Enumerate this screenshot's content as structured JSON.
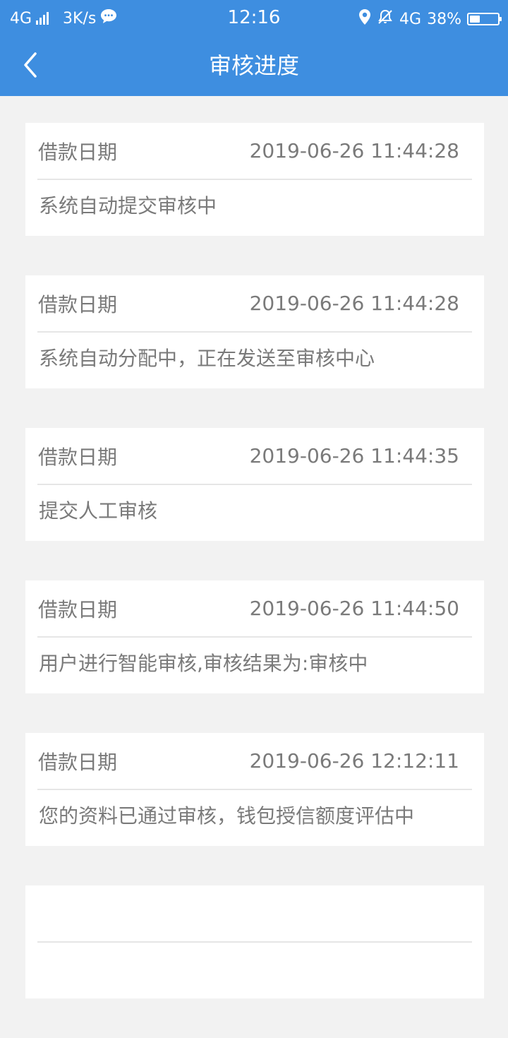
{
  "status_bar": {
    "network_type": "4G",
    "speed": "3K/s",
    "time": "12:16",
    "network_type_right": "4G",
    "battery_text": "38%",
    "battery_level": 0.38,
    "icons": [
      "signal-icon",
      "chat-icon",
      "location-icon",
      "alarm-off-icon",
      "battery-icon"
    ]
  },
  "header": {
    "title": "审核进度",
    "back_icon": "chevron-left-icon",
    "background": "#3e8ee0"
  },
  "records": [
    {
      "label": "借款日期",
      "datetime": "2019-06-26 11:44:28",
      "status": "系统自动提交审核中"
    },
    {
      "label": "借款日期",
      "datetime": "2019-06-26 11:44:28",
      "status": "系统自动分配中，正在发送至审核中心"
    },
    {
      "label": "借款日期",
      "datetime": "2019-06-26 11:44:35",
      "status": "提交人工审核"
    },
    {
      "label": "借款日期",
      "datetime": "2019-06-26 11:44:50",
      "status": "用户进行智能审核,审核结果为:审核中"
    },
    {
      "label": "借款日期",
      "datetime": "2019-06-26 12:12:11",
      "status": "您的资料已通过审核，钱包授信额度评估中"
    },
    {
      "label": "",
      "datetime": "",
      "status": ""
    }
  ],
  "colors": {
    "accent": "#3e8ee0",
    "page_background": "#f2f2f2",
    "card_background": "#ffffff",
    "text_secondary": "#7a7a7a",
    "divider": "#e6e6e6"
  }
}
